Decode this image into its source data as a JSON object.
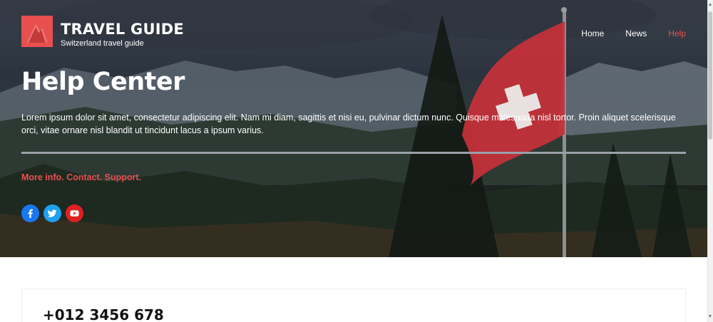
{
  "brand": {
    "name": "TRAVEL GUIDE",
    "tagline": "Switzerland travel guide",
    "logo_icon": "mountain-logo-icon"
  },
  "nav": {
    "items": [
      {
        "label": "Home",
        "active": false
      },
      {
        "label": "News",
        "active": false
      },
      {
        "label": "Help",
        "active": true
      }
    ]
  },
  "hero": {
    "title": "Help Center",
    "intro": "Lorem ipsum dolor sit amet, consectetur adipiscing elit. Nam mi diam, sagittis et nisi eu, pulvinar dictum nunc. Quisque malesuada nisl tortor. Proin aliquet scelerisque orci, vitae ornare nisl blandit ut tincidunt lacus a ipsum varius.",
    "subline": "More info. Contact. Support."
  },
  "social": {
    "icons": [
      "facebook-icon",
      "twitter-icon",
      "youtube-icon"
    ]
  },
  "contact": {
    "phone": "+012 3456 678"
  },
  "colors": {
    "accent": "#e8504f",
    "facebook": "#1877f2",
    "twitter": "#1da1f2",
    "youtube": "#e02020"
  }
}
